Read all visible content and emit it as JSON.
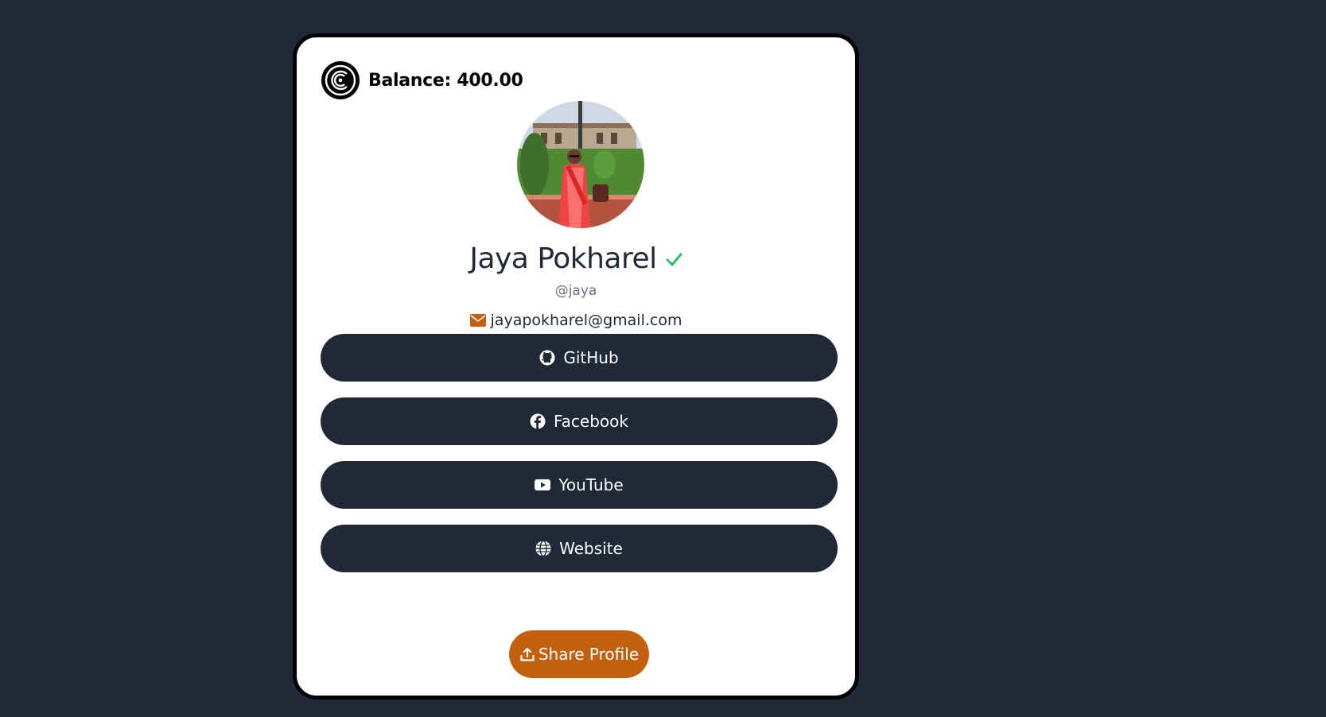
{
  "balance": {
    "label": "Balance: 400.00",
    "logo_icon": "coin-logo-icon"
  },
  "profile": {
    "name": "Jaya Pokharel",
    "verified_icon": "checkmark-icon",
    "handle": "@jaya",
    "email": "jayapokharel@gmail.com",
    "email_icon": "envelope-icon",
    "avatar_alt": "Jaya Pokharel"
  },
  "links": [
    {
      "label": "GitHub",
      "icon": "github-icon"
    },
    {
      "label": "Facebook",
      "icon": "facebook-icon"
    },
    {
      "label": "YouTube",
      "icon": "youtube-icon"
    },
    {
      "label": "Website",
      "icon": "globe-icon"
    }
  ],
  "share": {
    "label": "Share Profile",
    "icon": "upload-icon"
  },
  "colors": {
    "page_bg": "#1f2937",
    "card_bg": "#ffffff",
    "button_bg": "#1f2937",
    "accent": "#c2600f",
    "verified": "#22c55e"
  }
}
